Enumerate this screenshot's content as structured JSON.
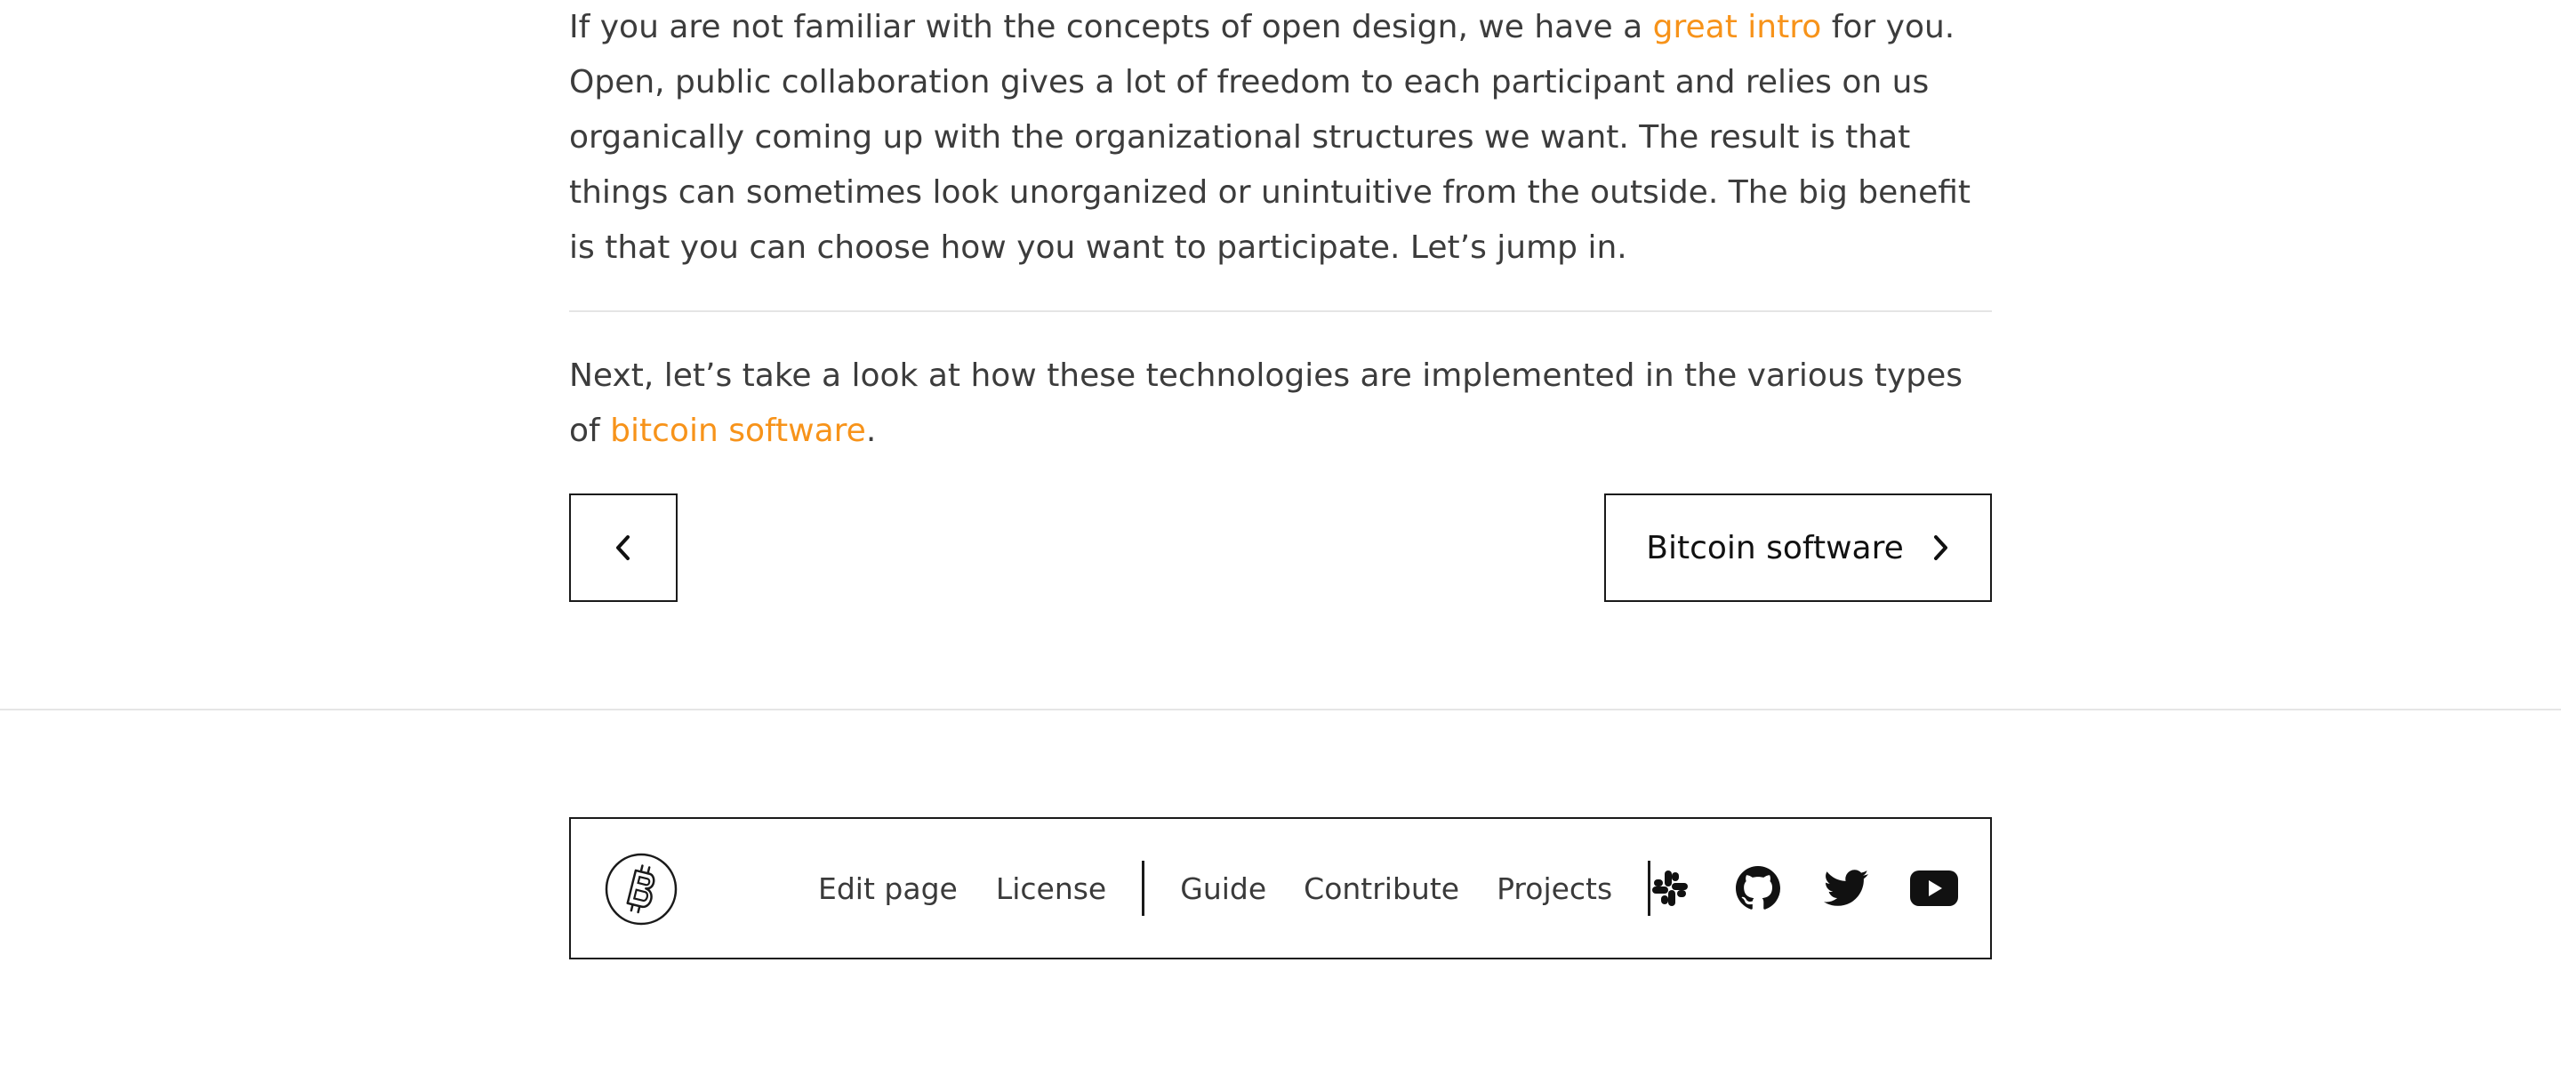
{
  "intro": {
    "text_before_link": "If you are not familiar with the concepts of open design, we have a ",
    "link_text": "great intro",
    "text_after_link": " for you. Open, public collaboration gives a lot of freedom to each participant and relies on us organically coming up with the organizational structures we want. The result is that things can sometimes look unorganized or unintuitive from the outside. The big benefit is that you can choose how you want to participate. Let’s jump in."
  },
  "next_section": {
    "text_before_link": "Next, let’s take a look at how these technologies are implemented in the various types of ",
    "link_text": "bitcoin software",
    "text_after_link": "."
  },
  "pagination": {
    "prev_icon": "chevron-left-icon",
    "next_label": "Bitcoin software",
    "next_icon": "chevron-right-icon"
  },
  "footer": {
    "logo_icon": "bitcoin-logo-icon",
    "links_group_1": [
      "Edit page",
      "License"
    ],
    "links_group_2": [
      "Guide",
      "Contribute",
      "Projects"
    ],
    "social_icons": [
      "slack-icon",
      "github-icon",
      "twitter-icon",
      "youtube-icon"
    ]
  },
  "colors": {
    "accent": "#f7931a",
    "text": "#3c3c3c",
    "border": "#1a1a1a",
    "divider": "#e5e5e5"
  }
}
